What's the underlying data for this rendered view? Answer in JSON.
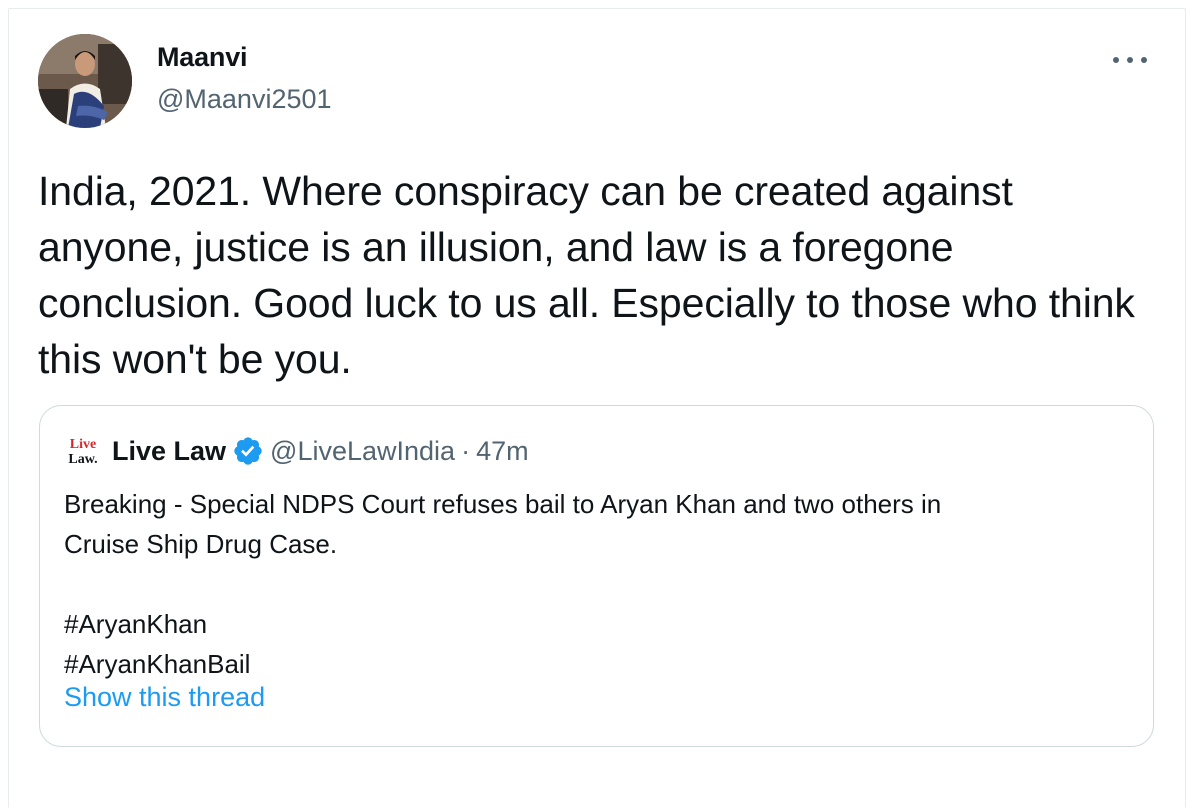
{
  "tweet": {
    "author": {
      "display_name": "Maanvi",
      "handle": "@Maanvi2501",
      "avatar": "profile-photo"
    },
    "more_icon": "more-horizontal-icon",
    "text": "India, 2021. Where conspiracy can be created against anyone, justice is an illusion, and law is a foregone conclusion. Good luck to us all. Especially to those who think this won't be you."
  },
  "quoted_tweet": {
    "logo": "live-law-logo",
    "logo_text_top": "Live",
    "logo_text_bottom": "Law.",
    "display_name": "Live Law",
    "verified_icon": "verified-badge-icon",
    "handle": "@LiveLawIndia",
    "separator": "·",
    "time": "47m",
    "body_lines": [
      "Breaking - Special NDPS Court refuses bail to Aryan Khan and two others in",
      "Cruise Ship Drug Case.",
      "",
      "#AryanKhan",
      "#AryanKhanBail"
    ],
    "show_thread": "Show this thread"
  },
  "colors": {
    "text": "#0f1419",
    "secondary": "#536471",
    "link": "#1d9bf0",
    "border": "#cfd9de",
    "live_law_red": "#d7262c"
  }
}
